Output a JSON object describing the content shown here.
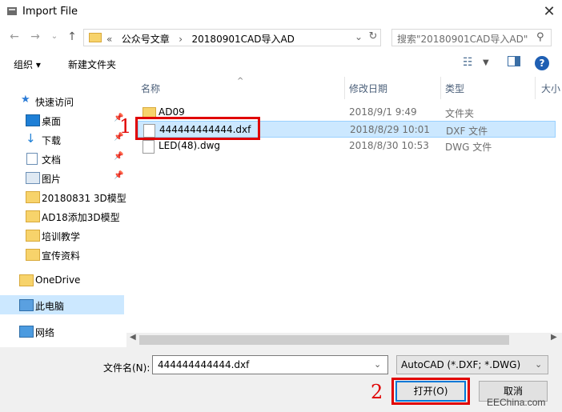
{
  "window": {
    "title": "Import File"
  },
  "address": {
    "prefix": "«",
    "path": [
      "公众号文章",
      "20180901CAD导入AD"
    ],
    "separator": "›"
  },
  "search": {
    "placeholder": "搜索\"20180901CAD导入AD\""
  },
  "toolbar": {
    "organize": "组织 ▾",
    "new_folder": "新建文件夹"
  },
  "sidebar": {
    "quick_access": "快速访问",
    "items": [
      {
        "label": "桌面",
        "pinned": true
      },
      {
        "label": "下载",
        "pinned": true
      },
      {
        "label": "文档",
        "pinned": true
      },
      {
        "label": "图片",
        "pinned": true
      },
      {
        "label": "20180831 3D模型"
      },
      {
        "label": "AD18添加3D模型"
      },
      {
        "label": "培训教学"
      },
      {
        "label": "宣传资料"
      }
    ],
    "onedrive": "OneDrive",
    "this_pc": "此电脑",
    "network": "网络"
  },
  "columns": {
    "name": "名称",
    "modified": "修改日期",
    "type": "类型",
    "size": "大小"
  },
  "files": [
    {
      "name": "AD09",
      "date": "2018/9/1 9:49",
      "type": "文件夹",
      "kind": "folder"
    },
    {
      "name": "444444444444.dxf",
      "date": "2018/8/29 10:01",
      "type": "DXF 文件",
      "kind": "file",
      "selected": true
    },
    {
      "name": "LED(48).dwg",
      "date": "2018/8/30 10:53",
      "type": "DWG 文件",
      "kind": "file"
    }
  ],
  "footer": {
    "filename_label": "文件名(N):",
    "filename_value": "444444444444.dxf",
    "filetype": "AutoCAD (*.DXF; *.DWG)",
    "open_label": "打开(O)",
    "cancel_label": "取消"
  },
  "annotations": {
    "step1": "1",
    "step2": "2"
  },
  "watermark": "EEChina.com",
  "colors": {
    "selection": "#cce8ff",
    "annotation_red": "#e00000",
    "help_blue": "#1f5fb3"
  }
}
